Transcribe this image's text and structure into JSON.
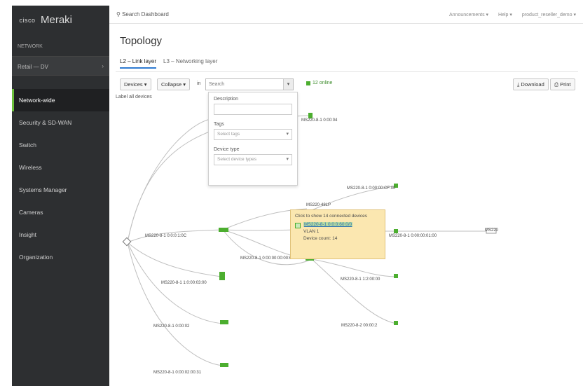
{
  "sidebar": {
    "logo_cisco": "cisco",
    "logo_meraki": "Meraki",
    "org_label": "NETWORK",
    "network_name": "Retail — DV",
    "items": [
      {
        "label": "Network-wide",
        "active": true
      },
      {
        "label": "Security & SD-WAN",
        "active": false
      },
      {
        "label": "Switch",
        "active": false
      },
      {
        "label": "Wireless",
        "active": false
      },
      {
        "label": "Systems Manager",
        "active": false
      },
      {
        "label": "Cameras",
        "active": false
      },
      {
        "label": "Insight",
        "active": false
      },
      {
        "label": "Organization",
        "active": false
      }
    ]
  },
  "topbar": {
    "search_placeholder": "Search Dashboard",
    "announcements": "Announcements",
    "help": "Help",
    "user": "product_reseller_demo"
  },
  "page": {
    "title": "Topology",
    "tabs": [
      {
        "label": "L2 – Link layer",
        "active": true
      },
      {
        "label": "L3 – Networking layer",
        "active": false
      }
    ]
  },
  "toolbar": {
    "devices_btn": "Devices",
    "collapse_btn": "Collapse",
    "in_label": "in",
    "search_value": "Search",
    "online_text": "12 online",
    "download_btn": "Download",
    "print_btn": "Print",
    "all_devices_label": "Label all devices"
  },
  "filter": {
    "description_label": "Description",
    "description_value": "",
    "tags_label": "Tags",
    "tags_placeholder": "Select tags",
    "device_type_label": "Device type",
    "device_type_placeholder": "Select device types"
  },
  "tooltip": {
    "title": "Click to show 14 connected devices",
    "device_link": "MS220-8-1 0:0:0:60:0/0",
    "vlan": "VLAN 1",
    "device_count": "Device count: 14"
  },
  "nodes": [
    {
      "label": "MS220-8-1 0:0:0:1:0C"
    },
    {
      "label": "MS220-48LP"
    },
    {
      "label": "MS220-8-1 0:00:00:CF:00"
    },
    {
      "label": "MS220-8-1 0:00:00:00:00:60"
    },
    {
      "label": "MS220-8-1 1:0:00:03:00"
    },
    {
      "label": "MS220-8-1 1:2:00:00"
    },
    {
      "label": "MS220-8-1 0:00:02"
    },
    {
      "label": "MS220-8-2 00:00:2"
    },
    {
      "label": "MS220-8-1 0:00:02:00:31"
    },
    {
      "label": "MS220-8-1 0:00:04"
    },
    {
      "label": "MS220-8-1 0:00:00:01:00"
    },
    {
      "label": "MS220"
    }
  ],
  "colors": {
    "sidebar_bg": "#2d2f31",
    "active_accent": "#6bbf3a",
    "node_green": "#4cae2f",
    "tooltip_bg": "#fbe7b0",
    "link_blue": "#2a6fb5"
  }
}
